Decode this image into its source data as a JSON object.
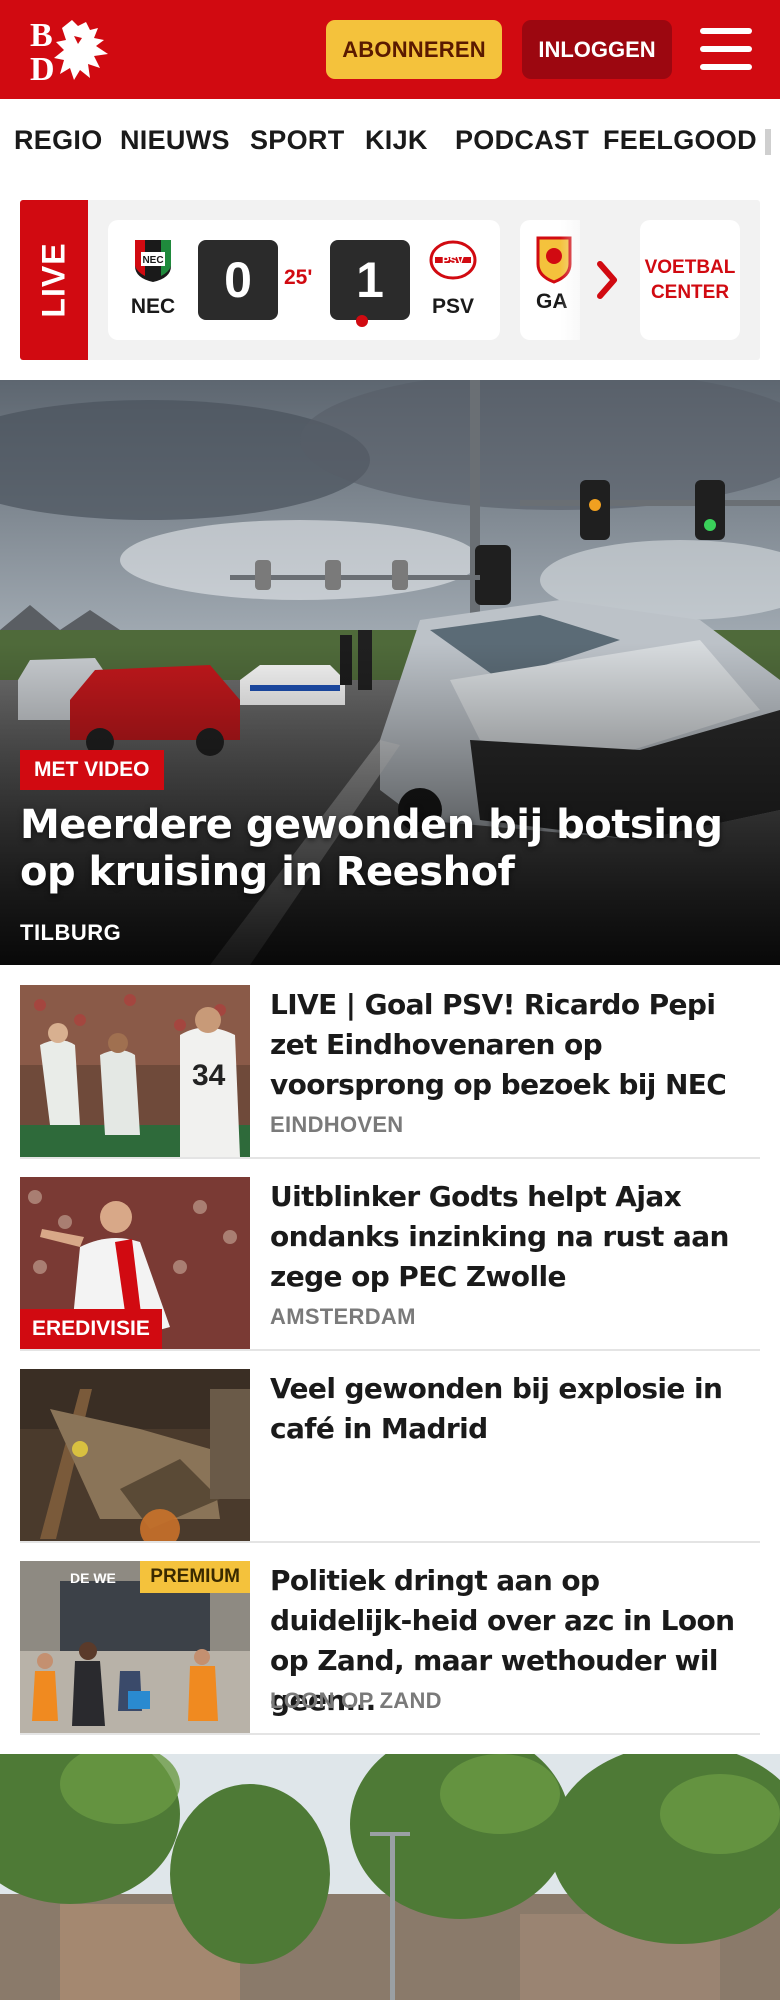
{
  "header": {
    "brand": "BD",
    "subscribe_label": "ABONNEREN",
    "login_label": "INLOGGEN",
    "brand_color": "#d10a11",
    "subscribe_color": "#f4c23c"
  },
  "nav": {
    "items": [
      "REGIO",
      "NIEUWS",
      "SPORT",
      "KIJK",
      "PODCAST",
      "FEELGOOD"
    ]
  },
  "live": {
    "label": "LIVE",
    "match": {
      "home_team": "NEC",
      "away_team": "PSV",
      "home_score": "0",
      "away_score": "1",
      "minute": "25'"
    },
    "next_match_team": "GA",
    "voetbal_center_line1": "VOETBAL",
    "voetbal_center_line2": "CENTER"
  },
  "hero": {
    "badge": "MET VIDEO",
    "title": "Meerdere gewonden bij botsing op kruising in Reeshof",
    "region": "TILBURG"
  },
  "articles": [
    {
      "title": "LIVE | Goal PSV! Ricardo Pepi zet Eindhovenaren op voorsprong op bezoek bij NEC",
      "region": "EINDHOVEN"
    },
    {
      "title": "Uitblinker Godts helpt Ajax ondanks inzinking na rust aan zege op PEC Zwolle",
      "region": "AMSTERDAM",
      "badge": "EREDIVISIE"
    },
    {
      "title": "Veel gewonden bij explosie in café in Madrid"
    },
    {
      "title": "Politiek dringt aan op duidelijk-heid over azc in Loon op Zand, maar wethouder wil geen...",
      "region": "LOON OP ZAND",
      "badge": "PREMIUM"
    }
  ]
}
